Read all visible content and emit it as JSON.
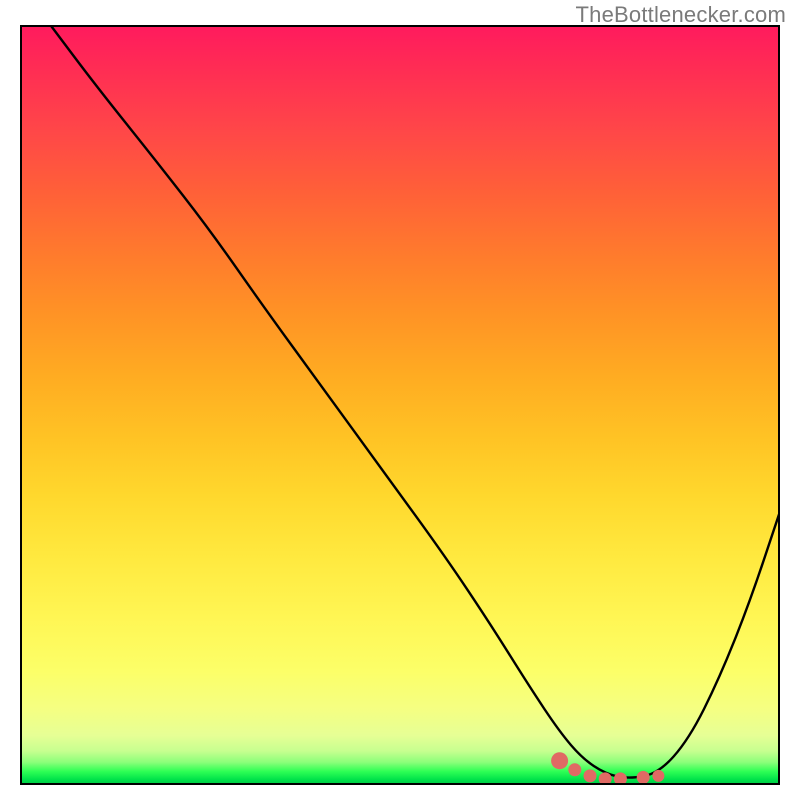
{
  "watermark": "TheBottlenecker.com",
  "chart_data": {
    "type": "line",
    "title": "",
    "xlabel": "",
    "ylabel": "",
    "xlim": [
      0,
      100
    ],
    "ylim": [
      0,
      100
    ],
    "grid": false,
    "series": [
      {
        "name": "bottleneck-curve",
        "x": [
          4,
          10,
          18,
          25,
          32,
          40,
          48,
          56,
          62,
          67,
          71,
          74,
          77,
          80,
          84,
          88,
          92,
          96,
          100
        ],
        "y": [
          100,
          92,
          82,
          73,
          63,
          52,
          41,
          30,
          21,
          13,
          7,
          3.5,
          1.5,
          0.8,
          1.5,
          6,
          14,
          24,
          36
        ]
      }
    ],
    "markers": {
      "name": "optimal-band",
      "color": "#e06a64",
      "x": [
        71,
        73,
        75,
        77,
        79,
        82,
        84
      ],
      "y": [
        3.2,
        2.0,
        1.2,
        0.8,
        0.8,
        1.0,
        1.2
      ]
    },
    "background_gradient": {
      "top": "#ff1a5e",
      "mid1": "#ff9325",
      "mid2": "#ffe93f",
      "bottom": "#00c545"
    }
  }
}
